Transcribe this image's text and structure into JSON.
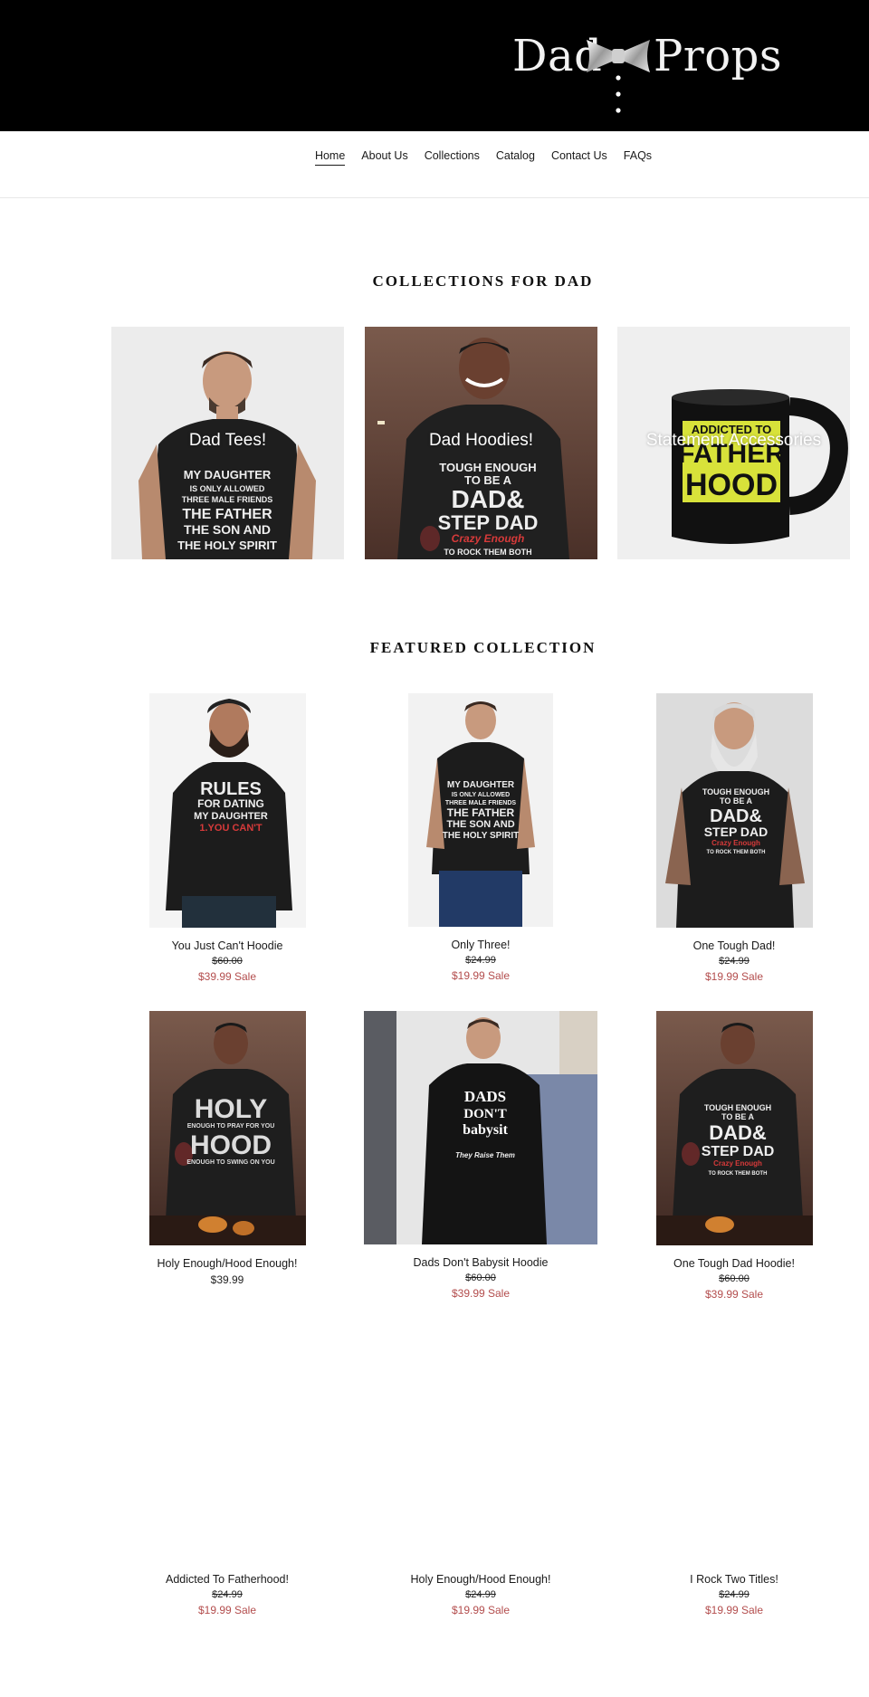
{
  "header": {
    "logo_left": "Dad",
    "logo_right": "Props",
    "bg": "#000000"
  },
  "nav": {
    "items": [
      {
        "label": "Home",
        "active": true
      },
      {
        "label": "About Us"
      },
      {
        "label": "Collections"
      },
      {
        "label": "Catalog"
      },
      {
        "label": "Contact Us"
      },
      {
        "label": "FAQs"
      }
    ]
  },
  "collections": {
    "title": "COLLECTIONS FOR DAD",
    "items": [
      {
        "label": "Dad Tees!",
        "shirt_lines": [
          "MY DAUGHTER",
          "IS ONLY ALLOWED",
          "THREE MALE FRIENDS",
          "THE FATHER",
          "THE SON AND",
          "THE HOLY SPIRIT"
        ]
      },
      {
        "label": "Dad Hoodies!",
        "shirt_lines": [
          "TOUGH ENOUGH",
          "TO BE A",
          "DAD&",
          "STEP DAD",
          "Crazy Enough",
          "TO ROCK THEM BOTH"
        ]
      },
      {
        "label": "Statement Accessories",
        "mug_lines": [
          "ADDICTED TO",
          "FATHER",
          "HOOD"
        ]
      }
    ]
  },
  "featured": {
    "title": "FEATURED COLLECTION",
    "products": [
      {
        "title": "You Just Can't Hoodie",
        "compare": "$60.00",
        "sale": "$39.99 Sale",
        "art": [
          "RULES",
          "FOR DATING",
          "MY DAUGHTER",
          "1.YOU CAN'T"
        ]
      },
      {
        "title": "Only Three!",
        "compare": "$24.99",
        "sale": "$19.99 Sale",
        "art": [
          "MY DAUGHTER",
          "IS ONLY ALLOWED",
          "THREE MALE FRIENDS",
          "THE FATHER",
          "THE SON AND",
          "THE HOLY SPIRIT"
        ]
      },
      {
        "title": "One Tough Dad!",
        "compare": "$24.99",
        "sale": "$19.99 Sale",
        "art": [
          "TOUGH ENOUGH",
          "TO BE A",
          "DAD&",
          "STEP DAD",
          "Crazy Enough",
          "TO ROCK THEM BOTH"
        ]
      },
      {
        "title": "Holy Enough/Hood Enough!",
        "price": "$39.99",
        "art": [
          "HOLY",
          "ENOUGH TO PRAY FOR YOU",
          "HOOD",
          "ENOUGH TO SWING ON YOU"
        ]
      },
      {
        "title": "Dads Don't Babysit Hoodie",
        "compare": "$60.00",
        "sale": "$39.99 Sale",
        "art": [
          "DADS",
          "DON'T",
          "babysit",
          "They Raise Them"
        ]
      },
      {
        "title": "One Tough Dad Hoodie!",
        "compare": "$60.00",
        "sale": "$39.99 Sale",
        "art": [
          "TOUGH ENOUGH",
          "TO BE A",
          "DAD&",
          "STEP DAD",
          "Crazy Enough",
          "TO ROCK THEM BOTH"
        ]
      },
      {
        "title": "Addicted To Fatherhood!",
        "compare": "$24.99",
        "sale": "$19.99 Sale"
      },
      {
        "title": "Holy Enough/Hood Enough!",
        "compare": "$24.99",
        "sale": "$19.99 Sale"
      },
      {
        "title": "I Rock Two Titles!",
        "compare": "$24.99",
        "sale": "$19.99 Sale"
      }
    ]
  },
  "colors": {
    "sale": "#b34d4d",
    "accent_red": "#d63a3a",
    "mug_yellow": "#d8e23a"
  }
}
